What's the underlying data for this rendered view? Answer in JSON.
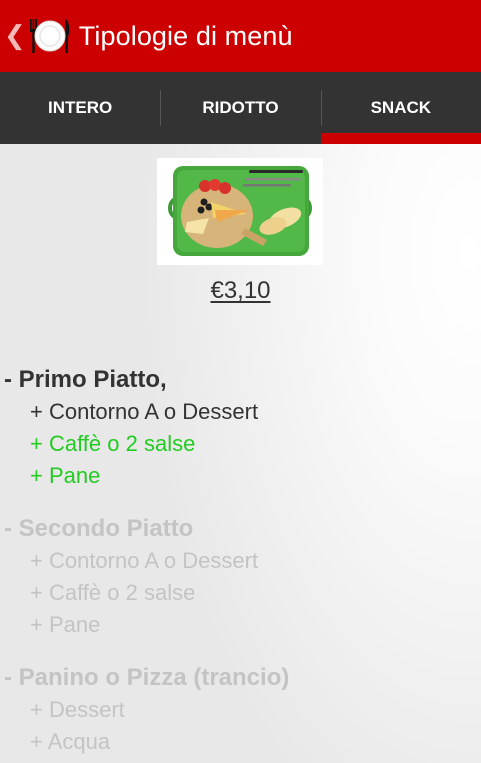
{
  "action_bar": {
    "title": "Tipologie di menù",
    "up_icon": "chevron-left-icon",
    "app_icon": "fork-plate-knife-icon",
    "background": "#cc0000"
  },
  "tabs": [
    {
      "label": "INTERO",
      "active": false
    },
    {
      "label": "RIDOTTO",
      "active": false
    },
    {
      "label": "SNACK",
      "active": true
    }
  ],
  "menu": {
    "image": "snack-tray-image",
    "price": "€3,10",
    "sections": [
      {
        "title": "- Primo Piatto,",
        "state": "available",
        "items": [
          {
            "label": "+ Contorno A o Dessert",
            "state": "normal"
          },
          {
            "label": "+ Caffè o 2 salse",
            "state": "included"
          },
          {
            "label": "+ Pane",
            "state": "included"
          }
        ]
      },
      {
        "title": "- Secondo Piatto",
        "state": "disabled",
        "items": [
          {
            "label": "+ Contorno A o Dessert",
            "state": "disabled"
          },
          {
            "label": "+ Caffè o 2 salse",
            "state": "disabled"
          },
          {
            "label": "+ Pane",
            "state": "disabled"
          }
        ]
      },
      {
        "title": "- Panino o Pizza (trancio)",
        "state": "disabled",
        "items": [
          {
            "label": "+ Dessert",
            "state": "disabled"
          },
          {
            "label": "+ Acqua",
            "state": "disabled"
          }
        ]
      }
    ]
  },
  "colors": {
    "accent": "#cc0000",
    "tab_bar": "#333333",
    "included_text": "#22cc22",
    "disabled_text": "#c4c4c4",
    "text": "#333333"
  }
}
